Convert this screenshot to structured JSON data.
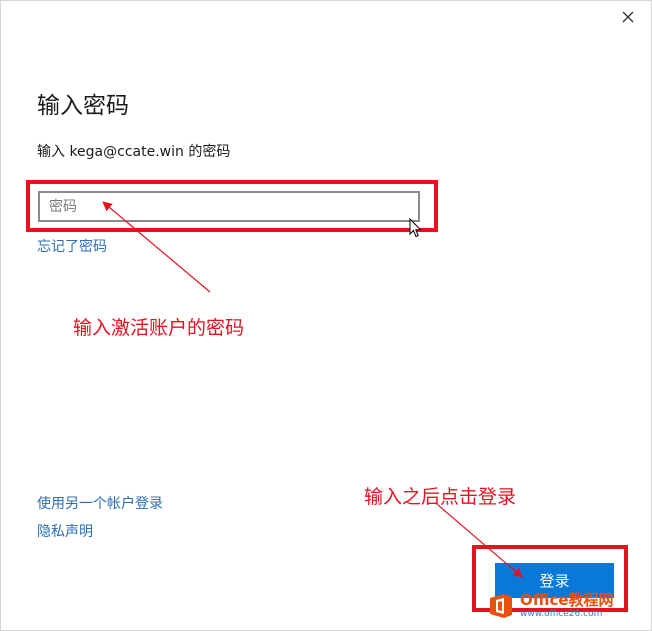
{
  "dialog": {
    "title": "输入密码",
    "subtitle": "输入 kega@ccate.win 的密码",
    "password_placeholder": "密码",
    "forgot_link": "忘记了密码",
    "other_account_link": "使用另一个帐户登录",
    "privacy_link": "隐私声明",
    "signin_button": "登录",
    "close_icon": "close-icon"
  },
  "annotations": {
    "note_password": "输入激活账户的密码",
    "note_signin": "输入之后点击登录",
    "highlight_color": "#e8111e"
  },
  "watermark": {
    "brand": "Office教程网",
    "url": "www.office26.com"
  },
  "colors": {
    "link": "#2a6fb8",
    "button": "#0a78d7",
    "watermark_orange": "#e8500e",
    "watermark_blue": "#2f7fd0"
  }
}
